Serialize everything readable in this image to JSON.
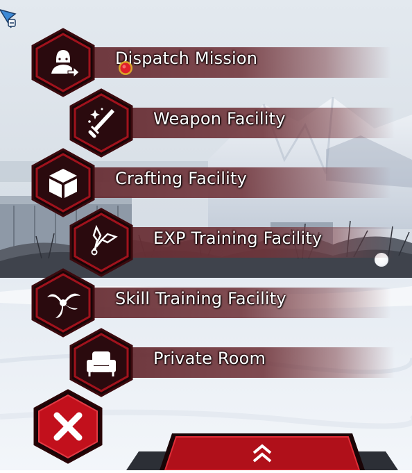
{
  "menu": {
    "items": [
      {
        "label": "Dispatch Mission",
        "icon": "dispatch-person-icon",
        "notification": true
      },
      {
        "label": "Weapon Facility",
        "icon": "sword-icon",
        "notification": false
      },
      {
        "label": "Crafting Facility",
        "icon": "crate-icon",
        "notification": false
      },
      {
        "label": "EXP Training Facility",
        "icon": "kunai-icon",
        "notification": false
      },
      {
        "label": "Skill Training Facility",
        "icon": "swirl-icon",
        "notification": false
      },
      {
        "label": "Private Room",
        "icon": "armchair-icon",
        "notification": false
      }
    ],
    "close_icon": "close-x-icon",
    "collapse_icon": "chevron-double-up-icon"
  },
  "colors": {
    "hex_fill": "#2a0a0e",
    "hex_border": "#a0121c",
    "banner": "#6e3036",
    "notification": "#e0202a",
    "close_button": "#c2101c"
  }
}
